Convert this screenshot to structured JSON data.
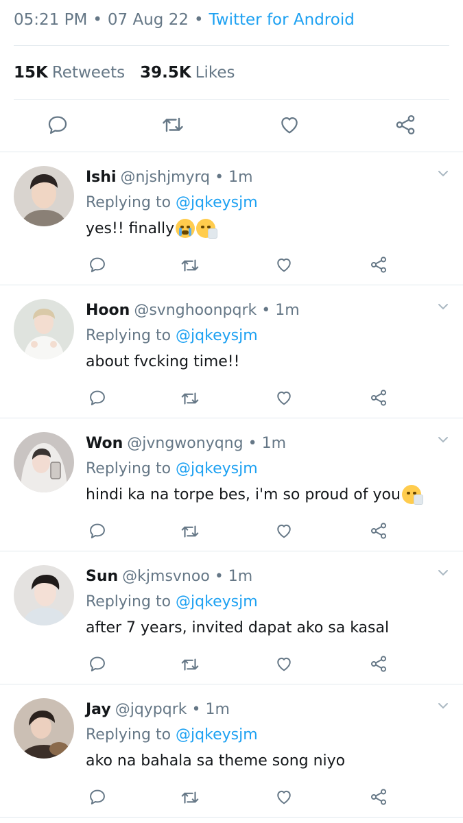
{
  "tweet": {
    "time": "05:21 PM",
    "date": "07 Aug 22",
    "source": "Twitter for Android",
    "retweets_count": "15K",
    "retweets_label": "Retweets",
    "likes_count": "39.5K",
    "likes_label": "Likes"
  },
  "actions": [
    "reply-icon",
    "retweet-icon",
    "like-icon",
    "share-icon"
  ],
  "replying_label": "Replying to",
  "replies": [
    {
      "name": "Ishi",
      "handle": "@njshjmyrq",
      "time": "1m",
      "to": "@jqkeysjm",
      "text": "yes!! finally",
      "emoji": [
        "loudly-crying-face",
        "sneezing-face"
      ]
    },
    {
      "name": "Hoon",
      "handle": "@svnghoonpqrk",
      "time": "1m",
      "to": "@jqkeysjm",
      "text": "about fvcking time!!",
      "emoji": []
    },
    {
      "name": "Won",
      "handle": "@jvngwonyqng",
      "time": "1m",
      "to": "@jqkeysjm",
      "text": "hindi ka na torpe bes, i'm so proud of you",
      "emoji": [
        "sneezing-face"
      ]
    },
    {
      "name": "Sun",
      "handle": "@kjmsvnoo",
      "time": "1m",
      "to": "@jqkeysjm",
      "text": "after 7 years, invited dapat ako sa kasal",
      "emoji": []
    },
    {
      "name": "Jay",
      "handle": "@jqypqrk",
      "time": "1m",
      "to": "@jqkeysjm",
      "text": "ako na bahala sa theme song niyo",
      "emoji": []
    }
  ],
  "colors": {
    "accent": "#1da1f2",
    "muted": "#657786",
    "divider": "#e1e8ed",
    "text": "#14171a"
  }
}
